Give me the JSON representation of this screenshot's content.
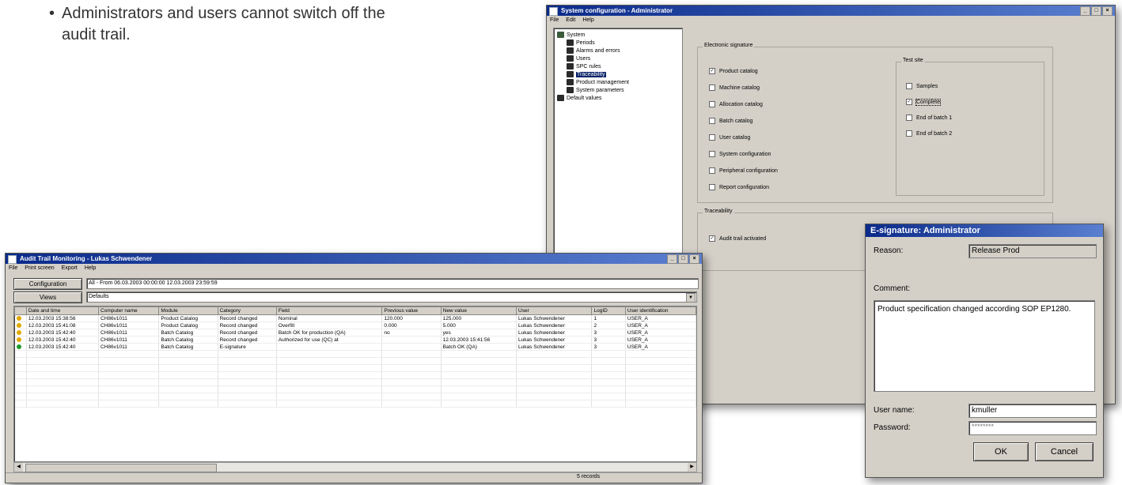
{
  "note": {
    "bullet": "•",
    "line1": "Administrators and users cannot switch off the",
    "line2": "audit trail."
  },
  "sysconfig": {
    "title": "System configuration - Administrator",
    "menu": [
      "File",
      "Edit",
      "Help"
    ],
    "tree": [
      {
        "label": "System",
        "level": 0
      },
      {
        "label": "Periods",
        "level": 1
      },
      {
        "label": "Alarms and errors",
        "level": 1
      },
      {
        "label": "Users",
        "level": 1
      },
      {
        "label": "SPC rules",
        "level": 1
      },
      {
        "label": "Traceability",
        "level": 1
      },
      {
        "label": "Product management",
        "level": 1
      },
      {
        "label": "System parameters",
        "level": 1
      },
      {
        "label": "Default values",
        "level": 0
      }
    ],
    "esig_group": "Electronic signature",
    "esig_items": [
      {
        "label": "Product catalog",
        "checked": true
      },
      {
        "label": "Machine catalog",
        "checked": false
      },
      {
        "label": "Allocation catalog",
        "checked": false
      },
      {
        "label": "Batch catalog",
        "checked": false
      },
      {
        "label": "User catalog",
        "checked": false
      },
      {
        "label": "System configuration",
        "checked": false
      },
      {
        "label": "Peripheral configuration",
        "checked": false
      },
      {
        "label": "Report configuration",
        "checked": false
      }
    ],
    "testsite_group": "Test site",
    "testsite_items": [
      {
        "label": "Samples",
        "checked": false
      },
      {
        "label": "Complete",
        "checked": true
      },
      {
        "label": "End of batch 1",
        "checked": false
      },
      {
        "label": "End of batch 2",
        "checked": false
      }
    ],
    "trace_group": "Traceability",
    "trace_items": [
      {
        "label": "Audit trail activated",
        "checked": true
      }
    ]
  },
  "audit": {
    "title": "Audit Trail Monitoring - Lukas Schwendener",
    "menu": [
      "File",
      "Print screen",
      "Export",
      "Help"
    ],
    "config_button": "Configuration",
    "config_value": "All - From 06.03.2003 00:00:00 12.03.2003 23:59:59",
    "views_button": "Views",
    "views_value": "Defaults",
    "columns": [
      "Date and time",
      "Computer name",
      "Module",
      "Category",
      "Field",
      "Previous value",
      "New value",
      "User",
      "LogID",
      "User identification"
    ],
    "rows": [
      {
        "status": "#e0a800",
        "cells": [
          "12.03.2003 15:38:56",
          "CH86v1011",
          "Product Catalog",
          "Record changed",
          "Nominal",
          "120.000",
          "125.000",
          "Lukas Schwendener",
          "1",
          "USER_A"
        ]
      },
      {
        "status": "#e0a800",
        "cells": [
          "12.03.2003 15:41:08",
          "CH86v1011",
          "Product Catalog",
          "Record changed",
          "Overfill",
          "0.000",
          "5.000",
          "Lukas Schwendener",
          "2",
          "USER_A"
        ]
      },
      {
        "status": "#e0a800",
        "cells": [
          "12.03.2003 15:42:40",
          "CH86v1011",
          "Batch Catalog",
          "Record changed",
          "Batch OK for production (QA)",
          "no",
          "yes",
          "Lukas Schwendener",
          "3",
          "USER_A"
        ]
      },
      {
        "status": "#e0a800",
        "cells": [
          "12.03.2003 15:42:40",
          "CH86v1011",
          "Batch Catalog",
          "Record changed",
          "Authorized for use (QC) at",
          "",
          "12.03.2003 15:41:56",
          "Lukas Schwendener",
          "3",
          "USER_A"
        ]
      },
      {
        "status": "#1a9a2a",
        "cells": [
          "12.03.2003 15:42:40",
          "CH86v1011",
          "Batch Catalog",
          "E-signature",
          "",
          "",
          "Batch OK (QA)",
          "Lukas Schwendener",
          "3",
          "USER_A"
        ]
      }
    ],
    "empty_rows": 8,
    "status_text": "5 records"
  },
  "esig_dialog": {
    "title": "E-signature: Administrator",
    "reason_label": "Reason:",
    "reason_value": "Release Prod",
    "comment_label": "Comment:",
    "comment_value": "Product specification changed according SOP EP1280.",
    "username_label": "User name:",
    "username_value": "kmuller",
    "password_label": "Password:",
    "password_value": "********",
    "ok_label": "OK",
    "cancel_label": "Cancel"
  }
}
